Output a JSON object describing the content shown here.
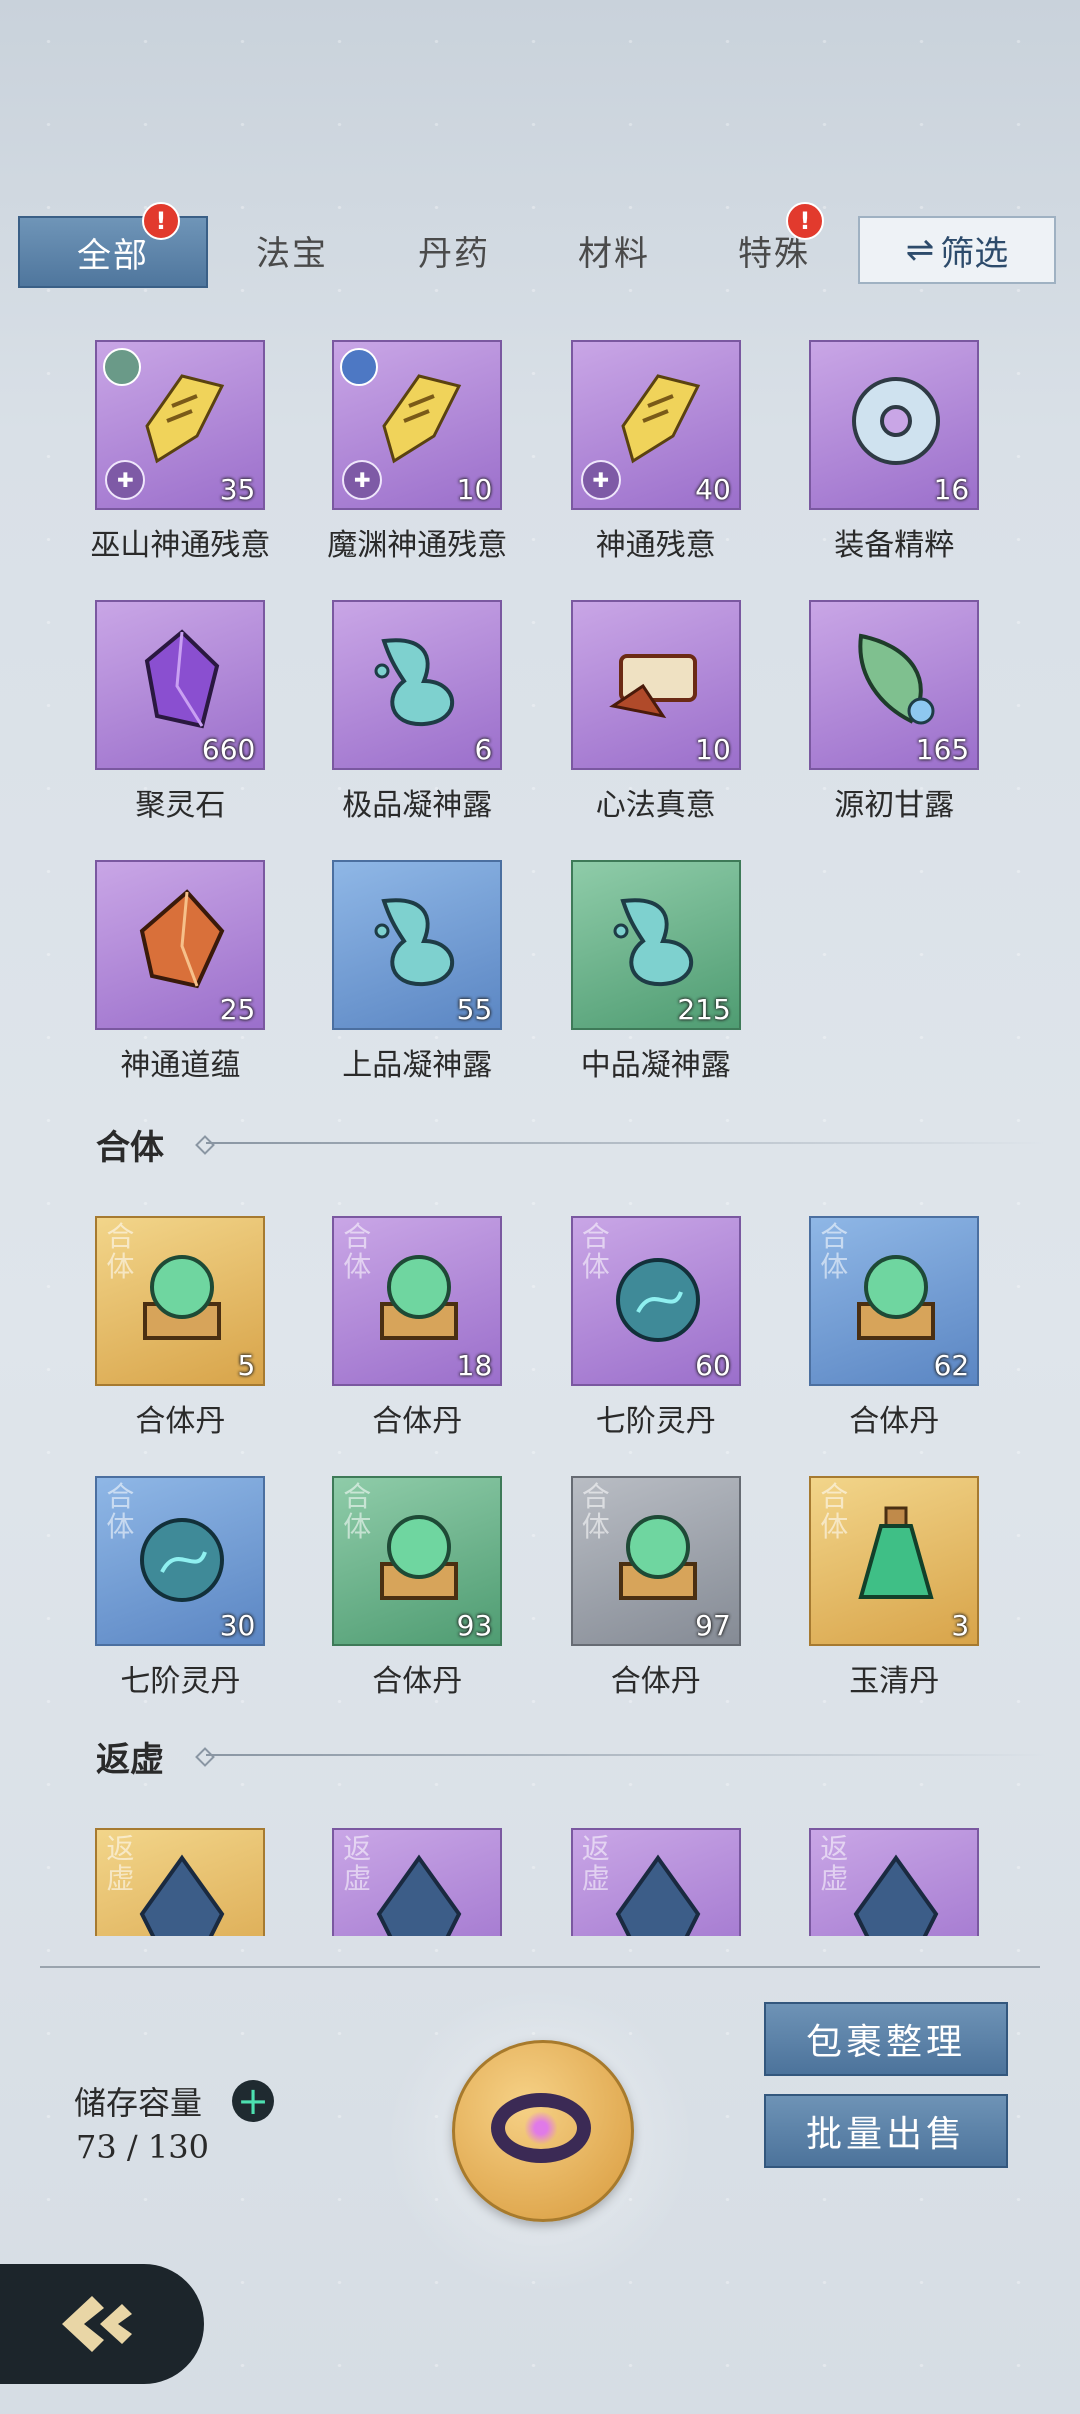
{
  "tabs": [
    {
      "label": "全部",
      "active": true,
      "badge": "!"
    },
    {
      "label": "法宝",
      "active": false,
      "badge": ""
    },
    {
      "label": "丹药",
      "active": false,
      "badge": ""
    },
    {
      "label": "材料",
      "active": false,
      "badge": ""
    },
    {
      "label": "特殊",
      "active": false,
      "badge": "!"
    }
  ],
  "filter_label": "筛选",
  "sections": [
    {
      "title": "合体"
    },
    {
      "title": "返虚"
    }
  ],
  "items_main": [
    {
      "name": "巫山神通残意",
      "count": "35",
      "quality": "purple",
      "icon": "golden-fragment-icon"
    },
    {
      "name": "魔渊神通残意",
      "count": "10",
      "quality": "purple",
      "icon": "golden-fragment-icon"
    },
    {
      "name": "神通残意",
      "count": "40",
      "quality": "purple",
      "icon": "golden-fragment-icon"
    },
    {
      "name": "装备精粹",
      "count": "16",
      "quality": "purple",
      "icon": "jade-ring-icon"
    },
    {
      "name": "聚灵石",
      "count": "660",
      "quality": "purple",
      "icon": "purple-crystal-icon"
    },
    {
      "name": "极品凝神露",
      "count": "6",
      "quality": "purple",
      "icon": "dew-drop-icon"
    },
    {
      "name": "心法真意",
      "count": "10",
      "quality": "purple",
      "icon": "scroll-relic-icon"
    },
    {
      "name": "源初甘露",
      "count": "165",
      "quality": "purple",
      "icon": "leaf-dew-icon"
    },
    {
      "name": "神通道蕴",
      "count": "25",
      "quality": "purple",
      "icon": "amber-crystal-icon"
    },
    {
      "name": "上品凝神露",
      "count": "55",
      "quality": "blue",
      "icon": "dew-drop-icon"
    },
    {
      "name": "中品凝神露",
      "count": "215",
      "quality": "green",
      "icon": "dew-drop-icon"
    }
  ],
  "items_heti": [
    {
      "name": "合体丹",
      "count": "5",
      "quality": "gold",
      "tag": "合体",
      "icon": "green-orb-icon"
    },
    {
      "name": "合体丹",
      "count": "18",
      "quality": "purple",
      "tag": "合体",
      "icon": "green-orb-icon"
    },
    {
      "name": "七阶灵丹",
      "count": "60",
      "quality": "purple",
      "tag": "合体",
      "icon": "blue-orb-icon"
    },
    {
      "name": "合体丹",
      "count": "62",
      "quality": "blue",
      "tag": "合体",
      "icon": "green-orb-icon"
    },
    {
      "name": "七阶灵丹",
      "count": "30",
      "quality": "blue",
      "tag": "合体",
      "icon": "blue-orb-icon"
    },
    {
      "name": "合体丹",
      "count": "93",
      "quality": "green",
      "tag": "合体",
      "icon": "green-orb-icon"
    },
    {
      "name": "合体丹",
      "count": "97",
      "quality": "gray",
      "tag": "合体",
      "icon": "green-orb-icon"
    },
    {
      "name": "玉清丹",
      "count": "3",
      "quality": "gold",
      "tag": "合体",
      "icon": "potion-bottle-icon"
    }
  ],
  "items_fanxu": [
    {
      "quality": "gold",
      "tag": "返虚",
      "icon": "crystal-shard-icon"
    },
    {
      "quality": "purple",
      "tag": "返虚",
      "icon": "crystal-shard-icon"
    },
    {
      "quality": "purple",
      "tag": "返虚",
      "icon": "crystal-shard-icon"
    },
    {
      "quality": "purple",
      "tag": "返虚",
      "icon": "crystal-shard-icon"
    }
  ],
  "storage": {
    "label": "储存容量",
    "value": "73 / 130"
  },
  "buttons": {
    "organize": "包裹整理",
    "bulk_sell": "批量出售"
  },
  "colors": {
    "active_tab": "#5b80a6",
    "badge": "#e23a2d",
    "purple_slot": "#b08ad9",
    "blue_slot": "#7aa2d8",
    "green_slot": "#6fb28c",
    "gold_slot": "#e6bd6a",
    "gray_slot": "#a0a5ad"
  }
}
